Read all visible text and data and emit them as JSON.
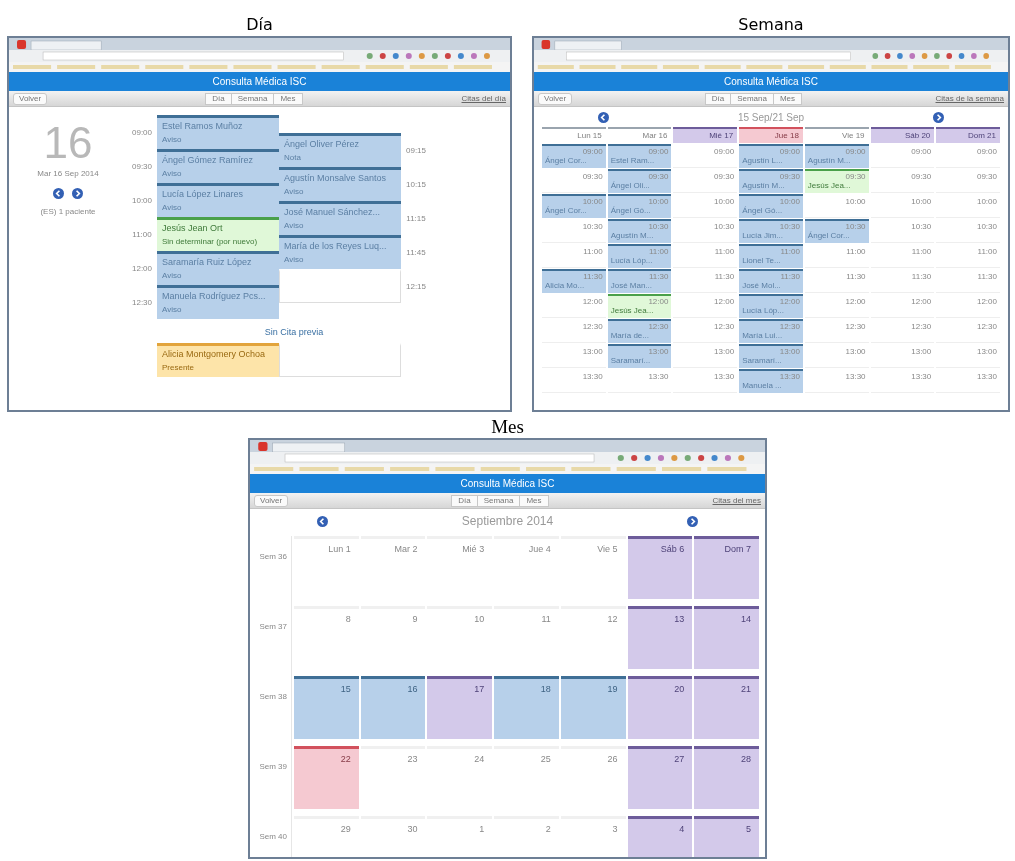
{
  "panels": [
    {
      "caption": "Día",
      "app_title": "Consulta Médica ISC",
      "back_button": "Volver",
      "view_tabs": [
        "Día",
        "Semana",
        "Mes"
      ],
      "list_link": "Citas del día",
      "day": {
        "number": "16",
        "date": "Mar 16 Sep 2014",
        "summary": "(ES) 1 paciente",
        "columns": [
          [
            {
              "kind": "scheduled",
              "time": "09:00",
              "name": "Estel Ramos Muñoz",
              "note": "Aviso"
            },
            {
              "kind": "scheduled",
              "time": "09:30",
              "name": "Ángel Gómez Ramírez",
              "note": "Aviso"
            },
            {
              "kind": "scheduled",
              "time": "10:00",
              "name": "Lucía López Linares",
              "note": "Aviso"
            },
            {
              "kind": "pending",
              "time": "11:00",
              "name": "Jesús Jean Ort",
              "note": "Sin determinar (por nuevo)"
            },
            {
              "kind": "scheduled",
              "time": "12:00",
              "name": "Saramaría Ruiz López",
              "note": "Aviso"
            },
            {
              "kind": "scheduled",
              "time": "12:30",
              "name": "Manuela Rodríguez Pcs...",
              "note": "Aviso"
            }
          ],
          [
            {
              "kind": "scheduled",
              "time": "09:15",
              "name": "Ángel Oliver Pérez",
              "note": "Nota"
            },
            {
              "kind": "scheduled",
              "time": "10:15",
              "name": "Agustín Monsalve Santos",
              "note": "Aviso"
            },
            {
              "kind": "scheduled",
              "time": "11:15",
              "name": "José Manuel Sánchez...",
              "note": "Aviso"
            },
            {
              "kind": "scheduled",
              "time": "11:45",
              "name": "María de los Reyes Luq...",
              "note": "Aviso"
            },
            {
              "kind": "empty",
              "time": "12:15"
            }
          ]
        ],
        "walk_in_title": "Sin Cita previa",
        "walk_ins": [
          {
            "kind": "walkin",
            "name": "Alicia Montgomery Ochoa",
            "note": "Presente"
          },
          {
            "kind": "empty"
          }
        ]
      }
    },
    {
      "caption": "Semana",
      "app_title": "Consulta Médica ISC",
      "back_button": "Volver",
      "view_tabs": [
        "Día",
        "Semana",
        "Mes"
      ],
      "list_link": "Citas de la semana",
      "week": {
        "range": "15 Sep/21 Sep",
        "days": [
          {
            "label": "Lun 15",
            "kind": "normal"
          },
          {
            "label": "Mar 16",
            "kind": "normal"
          },
          {
            "label": "Mié 17",
            "kind": "holiday"
          },
          {
            "label": "Jue 18",
            "kind": "today"
          },
          {
            "label": "Vie 19",
            "kind": "normal"
          },
          {
            "label": "Sáb 20",
            "kind": "holiday"
          },
          {
            "label": "Dom 21",
            "kind": "holiday"
          }
        ],
        "rows": [
          [
            {
              "kind": "appt",
              "time": "09:00",
              "name": "Ángel Cor..."
            },
            {
              "kind": "appt",
              "time": "09:00",
              "name": "Estel Ram..."
            },
            {
              "kind": "free",
              "time": "09:00"
            },
            {
              "kind": "appt",
              "time": "09:00",
              "name": "Agustín L..."
            },
            {
              "kind": "appt",
              "time": "09:00",
              "name": "Agustín M..."
            },
            {
              "kind": "free",
              "time": "09:00"
            },
            {
              "kind": "free",
              "time": "09:00"
            }
          ],
          [
            {
              "kind": "free",
              "time": "09:30"
            },
            {
              "kind": "appt",
              "time": "09:30",
              "name": "Ángel Oli..."
            },
            {
              "kind": "free",
              "time": "09:30"
            },
            {
              "kind": "appt",
              "time": "09:30",
              "name": "Agustín M..."
            },
            {
              "kind": "pending",
              "time": "09:30",
              "name": "Jesús Jea..."
            },
            {
              "kind": "free",
              "time": "09:30"
            },
            {
              "kind": "free",
              "time": "09:30"
            }
          ],
          [
            {
              "kind": "appt",
              "time": "10:00",
              "name": "Ángel Cor..."
            },
            {
              "kind": "appt",
              "time": "10:00",
              "name": "Ángel Gó..."
            },
            {
              "kind": "free",
              "time": "10:00"
            },
            {
              "kind": "appt",
              "time": "10:00",
              "name": "Ángel Gó..."
            },
            {
              "kind": "free",
              "time": "10:00"
            },
            {
              "kind": "free",
              "time": "10:00"
            },
            {
              "kind": "free",
              "time": "10:00"
            }
          ],
          [
            {
              "kind": "free",
              "time": "10:30"
            },
            {
              "kind": "appt",
              "time": "10:30",
              "name": "Agustín M..."
            },
            {
              "kind": "free",
              "time": "10:30"
            },
            {
              "kind": "appt",
              "time": "10:30",
              "name": "Lucía Jim..."
            },
            {
              "kind": "appt",
              "time": "10:30",
              "name": "Ángel Cor..."
            },
            {
              "kind": "free",
              "time": "10:30"
            },
            {
              "kind": "free",
              "time": "10:30"
            }
          ],
          [
            {
              "kind": "free",
              "time": "11:00"
            },
            {
              "kind": "appt",
              "time": "11:00",
              "name": "Lucía Lóp..."
            },
            {
              "kind": "free",
              "time": "11:00"
            },
            {
              "kind": "appt",
              "time": "11:00",
              "name": "Lionel Te..."
            },
            {
              "kind": "free",
              "time": "11:00"
            },
            {
              "kind": "free",
              "time": "11:00"
            },
            {
              "kind": "free",
              "time": "11:00"
            }
          ],
          [
            {
              "kind": "appt",
              "time": "11:30",
              "name": "Alicia Mo..."
            },
            {
              "kind": "appt",
              "time": "11:30",
              "name": "José Man..."
            },
            {
              "kind": "free",
              "time": "11:30"
            },
            {
              "kind": "appt",
              "time": "11:30",
              "name": "José Mol..."
            },
            {
              "kind": "free",
              "time": "11:30"
            },
            {
              "kind": "free",
              "time": "11:30"
            },
            {
              "kind": "free",
              "time": "11:30"
            }
          ],
          [
            {
              "kind": "free",
              "time": "12:00"
            },
            {
              "kind": "pending",
              "time": "12:00",
              "name": "Jesús Jea..."
            },
            {
              "kind": "free",
              "time": "12:00"
            },
            {
              "kind": "appt",
              "time": "12:00",
              "name": "Lucía Lóp..."
            },
            {
              "kind": "free",
              "time": "12:00"
            },
            {
              "kind": "free",
              "time": "12:00"
            },
            {
              "kind": "free",
              "time": "12:00"
            }
          ],
          [
            {
              "kind": "free",
              "time": "12:30"
            },
            {
              "kind": "appt",
              "time": "12:30",
              "name": "María de..."
            },
            {
              "kind": "free",
              "time": "12:30"
            },
            {
              "kind": "appt",
              "time": "12:30",
              "name": "María Lui..."
            },
            {
              "kind": "free",
              "time": "12:30"
            },
            {
              "kind": "free",
              "time": "12:30"
            },
            {
              "kind": "free",
              "time": "12:30"
            }
          ],
          [
            {
              "kind": "free",
              "time": "13:00"
            },
            {
              "kind": "appt",
              "time": "13:00",
              "name": "Saramarí..."
            },
            {
              "kind": "free",
              "time": "13:00"
            },
            {
              "kind": "appt",
              "time": "13:00",
              "name": "Saramarí..."
            },
            {
              "kind": "free",
              "time": "13:00"
            },
            {
              "kind": "free",
              "time": "13:00"
            },
            {
              "kind": "free",
              "time": "13:00"
            }
          ],
          [
            {
              "kind": "free",
              "time": "13:30"
            },
            {
              "kind": "free",
              "time": "13:30"
            },
            {
              "kind": "free",
              "time": "13:30"
            },
            {
              "kind": "appt",
              "time": "13:30",
              "name": "Manuela ..."
            },
            {
              "kind": "free",
              "time": "13:30"
            },
            {
              "kind": "free",
              "time": "13:30"
            },
            {
              "kind": "free",
              "time": "13:30"
            }
          ]
        ]
      }
    },
    {
      "caption": "Mes",
      "app_title": "Consulta Médica ISC",
      "back_button": "Volver",
      "view_tabs": [
        "Día",
        "Semana",
        "Mes"
      ],
      "list_link": "Citas del mes",
      "month": {
        "title": "Septiembre 2014",
        "weeks": [
          {
            "label": "Sem 36",
            "days": [
              {
                "label": "Lun 1",
                "kind": "free"
              },
              {
                "label": "Mar 2",
                "kind": "free"
              },
              {
                "label": "Mié 3",
                "kind": "free"
              },
              {
                "label": "Jue 4",
                "kind": "free"
              },
              {
                "label": "Vie 5",
                "kind": "free"
              },
              {
                "label": "Sáb 6",
                "kind": "holiday"
              },
              {
                "label": "Dom 7",
                "kind": "holiday"
              }
            ]
          },
          {
            "label": "Sem 37",
            "days": [
              {
                "label": "8",
                "kind": "free"
              },
              {
                "label": "9",
                "kind": "free"
              },
              {
                "label": "10",
                "kind": "free"
              },
              {
                "label": "11",
                "kind": "free"
              },
              {
                "label": "12",
                "kind": "free"
              },
              {
                "label": "13",
                "kind": "holiday"
              },
              {
                "label": "14",
                "kind": "holiday"
              }
            ]
          },
          {
            "label": "Sem 38",
            "days": [
              {
                "label": "15",
                "kind": "busy"
              },
              {
                "label": "16",
                "kind": "busy"
              },
              {
                "label": "17",
                "kind": "holiday"
              },
              {
                "label": "18",
                "kind": "busy"
              },
              {
                "label": "19",
                "kind": "busy"
              },
              {
                "label": "20",
                "kind": "holiday"
              },
              {
                "label": "21",
                "kind": "holiday"
              }
            ]
          },
          {
            "label": "Sem 39",
            "days": [
              {
                "label": "22",
                "kind": "today"
              },
              {
                "label": "23",
                "kind": "free"
              },
              {
                "label": "24",
                "kind": "free"
              },
              {
                "label": "25",
                "kind": "free"
              },
              {
                "label": "26",
                "kind": "free"
              },
              {
                "label": "27",
                "kind": "holiday"
              },
              {
                "label": "28",
                "kind": "holiday"
              }
            ]
          },
          {
            "label": "Sem 40",
            "days": [
              {
                "label": "29",
                "kind": "free"
              },
              {
                "label": "30",
                "kind": "free"
              },
              {
                "label": "1",
                "kind": "free"
              },
              {
                "label": "2",
                "kind": "free"
              },
              {
                "label": "3",
                "kind": "free"
              },
              {
                "label": "4",
                "kind": "holiday"
              },
              {
                "label": "5",
                "kind": "holiday"
              }
            ]
          }
        ]
      }
    }
  ]
}
